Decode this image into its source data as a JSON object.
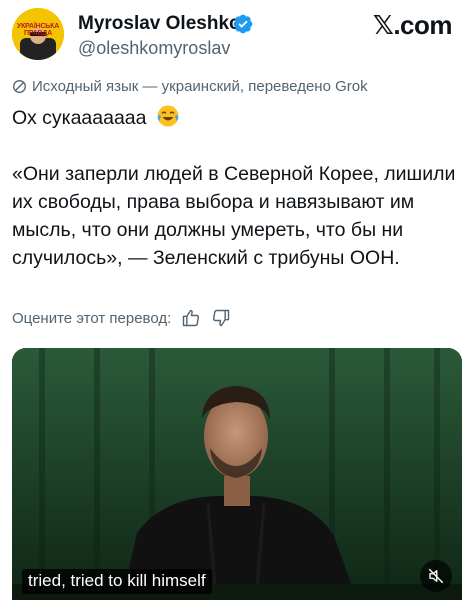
{
  "author": {
    "name": "Myroslav Oleshko",
    "handle": "@oleshkomyroslav",
    "avatar_text": "УКРАЇНСЬКА ПРАВДА"
  },
  "brand": {
    "x": "𝕏",
    "suffix": ".com"
  },
  "translation_note": "Исходный язык — украинский, переведено Grok",
  "tweet": {
    "line1": "Ох сукааааааа",
    "line1_emoji": "face-with-tears-of-joy",
    "quote": "«Они заперли людей в Северной Корее, лишили их свободы, права выбора и навязывают им мысль, что они должны умереть, что бы ни случилось», — Зеленский с трибуны ООН."
  },
  "rate": {
    "label": "Оцените этот перевод:"
  },
  "video": {
    "caption": "tried, tried to kill himself"
  },
  "colors": {
    "text": "#0f1419",
    "secondary": "#536471",
    "verified": "#1d9bf0",
    "avatar_bg": "#f5c400",
    "stage": "#1e4a2e"
  },
  "icons": {
    "verified": "verified-badge-icon",
    "translate": "translate-icon",
    "thumbs_up": "thumbs-up-icon",
    "thumbs_down": "thumbs-down-icon",
    "mute": "muted-speaker-icon"
  }
}
